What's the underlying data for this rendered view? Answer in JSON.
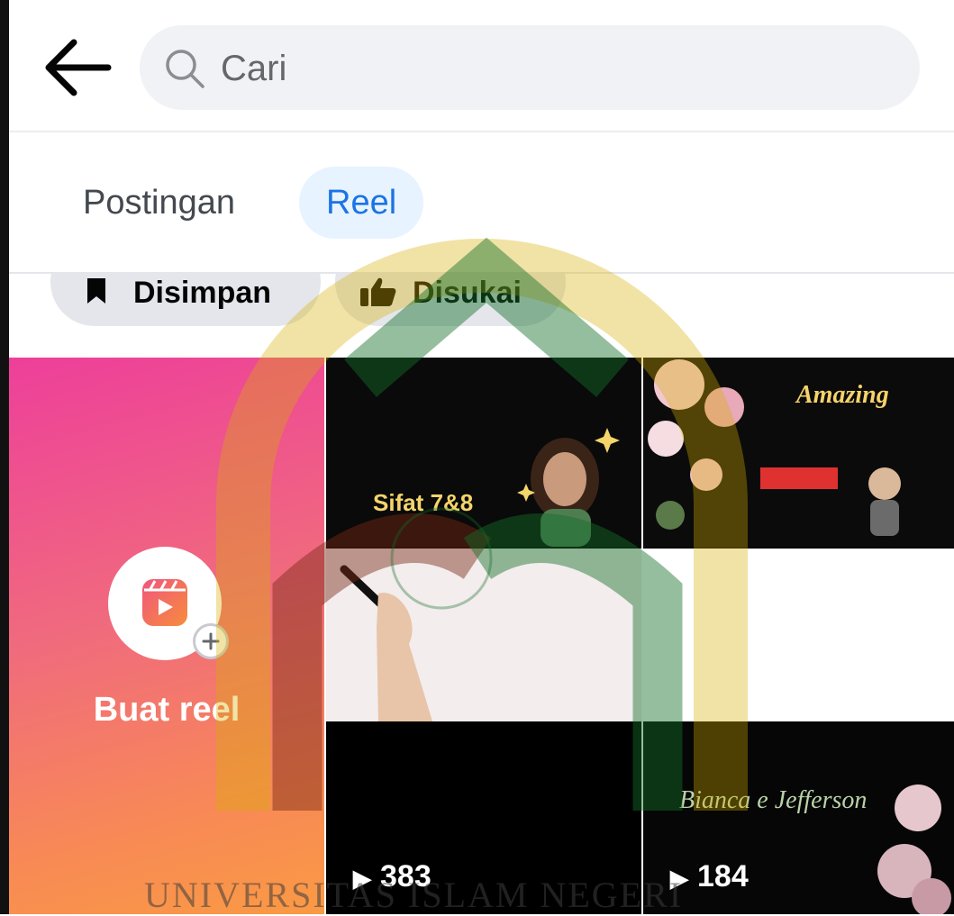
{
  "header": {
    "back_icon": "arrow-left-icon",
    "search": {
      "placeholder": "Cari",
      "icon": "search-icon"
    }
  },
  "tabs": [
    {
      "label": "Postingan",
      "active": false
    },
    {
      "label": "Reel",
      "active": true
    }
  ],
  "filters": [
    {
      "label": "Disimpan",
      "icon": "bookmark-icon"
    },
    {
      "label": "Disukai",
      "icon": "thumbs-up-icon"
    }
  ],
  "create_reel": {
    "label": "Buat reel",
    "icon": "reels-icon",
    "badge_icon": "plus-icon"
  },
  "reels": [
    {
      "caption": "Sifat 7&8",
      "plays": "383",
      "play_icon": "play-icon"
    },
    {
      "caption": "Amazing",
      "plays": "184",
      "play_icon": "play-icon",
      "signature": "Bianca e Jefferson"
    }
  ],
  "watermark": {
    "text": "UNIVERSITAS ISLAM NEGERI"
  },
  "colors": {
    "accent": "#1b74e4",
    "tab_active_bg": "#e7f3ff",
    "chip_bg": "#e4e6eb",
    "search_bg": "#f0f2f5"
  }
}
